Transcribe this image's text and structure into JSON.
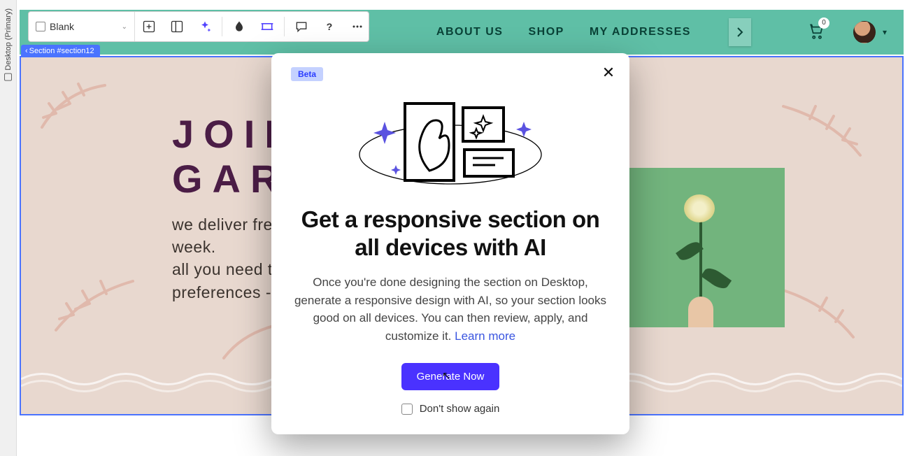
{
  "sidebar": {
    "label": "Desktop (Primary)"
  },
  "toolbar": {
    "select_label": "Blank"
  },
  "section_badge": "Section #section12",
  "nav": {
    "items": [
      "ABOUT US",
      "SHOP",
      "MY ADDRESSES"
    ],
    "cart_count": "0"
  },
  "hero": {
    "title_line1": "JOIN",
    "title_line2": "GAR",
    "subtitle_line1": "we deliver fresh",
    "subtitle_line2": "week.",
    "subtitle_line3": "all you need to d",
    "subtitle_line4": "preferences - w"
  },
  "modal": {
    "badge": "Beta",
    "title": "Get a responsive section on all devices with AI",
    "body": "Once you're done designing the section on Desktop, generate a responsive design with AI, so your section looks good on all devices. You can then review, apply, and customize it. ",
    "learn_more": "Learn more",
    "cta": "Generate Now",
    "dont_show": "Don't show again"
  }
}
